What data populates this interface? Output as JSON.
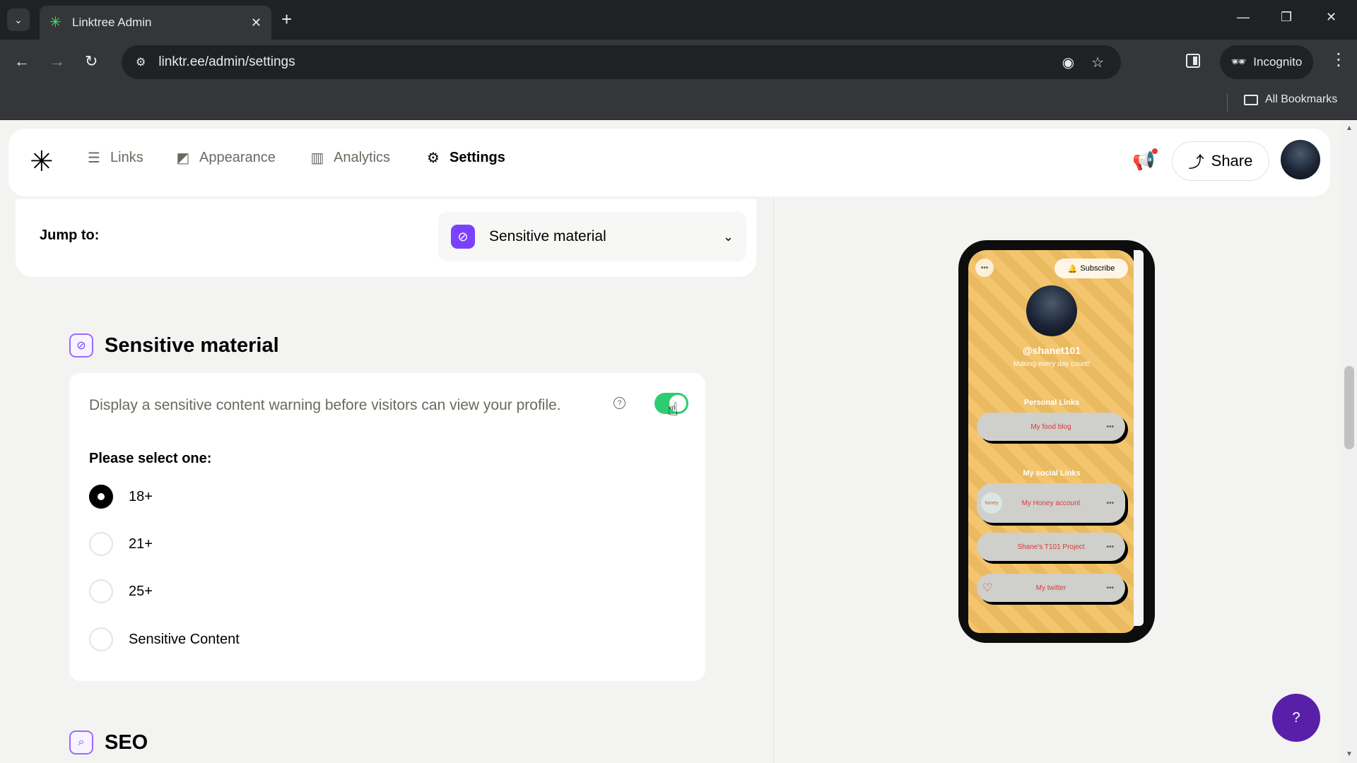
{
  "browser": {
    "tab_title": "Linktree Admin",
    "url": "linktr.ee/admin/settings",
    "incognito_label": "Incognito",
    "all_bookmarks": "All Bookmarks"
  },
  "nav": {
    "items": [
      {
        "label": "Links",
        "icon": "links-icon"
      },
      {
        "label": "Appearance",
        "icon": "appearance-icon"
      },
      {
        "label": "Analytics",
        "icon": "analytics-icon"
      },
      {
        "label": "Settings",
        "icon": "settings-icon",
        "active": true
      }
    ],
    "share_label": "Share"
  },
  "jump": {
    "label": "Jump to:",
    "selected": "Sensitive material"
  },
  "sensitive": {
    "title": "Sensitive material",
    "description": "Display a sensitive content warning before visitors can view your profile.",
    "toggle_on": true,
    "select_label": "Please select one:",
    "options": [
      {
        "label": "18+",
        "selected": true
      },
      {
        "label": "21+",
        "selected": false
      },
      {
        "label": "25+",
        "selected": false
      },
      {
        "label": "Sensitive Content",
        "selected": false
      }
    ]
  },
  "seo": {
    "title": "SEO"
  },
  "preview": {
    "subscribe_label": "Subscribe",
    "handle": "@shanet101",
    "bio": "Making every day count!",
    "personal_heading": "Personal Links",
    "social_heading": "My social Links",
    "links": [
      {
        "label": "My food blog"
      },
      {
        "label": "My Honey account"
      },
      {
        "label": "Shane's T101 Project"
      },
      {
        "label": "My twitter"
      }
    ]
  },
  "colors": {
    "accent_purple": "#7c41ff",
    "toggle_green": "#2ecc71",
    "preview_bg": "#f2c063",
    "help_fab": "#5a1fa8"
  }
}
